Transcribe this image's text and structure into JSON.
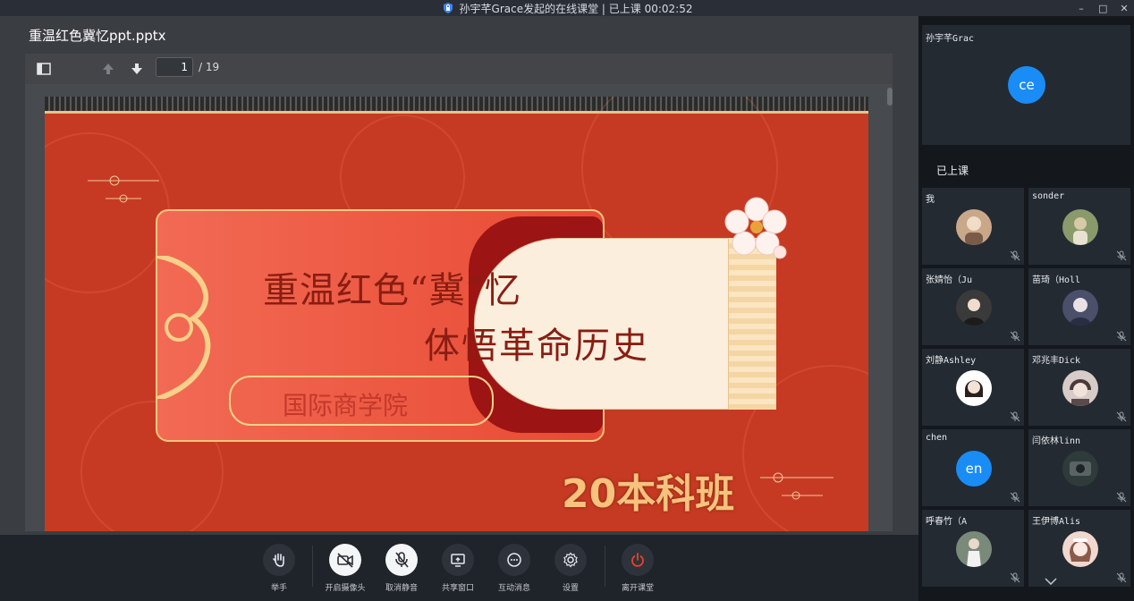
{
  "window": {
    "title": "孙宇芊Grace发起的在线课堂 | 已上课 00:02:52",
    "controls": [
      "–",
      "□",
      "✕"
    ]
  },
  "viewer": {
    "file_name": "重温红色冀忆ppt.pptx",
    "page_current": "1",
    "page_total": "/ 19"
  },
  "slide": {
    "title_line1": "重温红色“冀”忆",
    "title_line2": "体悟革命历史",
    "school": "国际商学院",
    "class_label": "20本科班"
  },
  "controls": [
    {
      "name": "raise-hand",
      "label": "举手",
      "icon": "hand-icon"
    },
    {
      "name": "camera",
      "label": "开启摄像头",
      "icon": "camera-off-icon"
    },
    {
      "name": "mute",
      "label": "取消静音",
      "icon": "mic-off-icon"
    },
    {
      "name": "share",
      "label": "共享窗口",
      "icon": "screen-share-icon"
    },
    {
      "name": "chat",
      "label": "互动消息",
      "icon": "chat-icon"
    },
    {
      "name": "settings",
      "label": "设置",
      "icon": "gear-icon"
    },
    {
      "name": "leave",
      "label": "离开课堂",
      "icon": "power-icon"
    }
  ],
  "panel": {
    "teacher_name": "孙宇芊Grac",
    "teacher_initials": "ce",
    "section_label": "已上课",
    "participants": [
      {
        "name": "我",
        "avatar": "photo",
        "color": "#c9a88a"
      },
      {
        "name": "sonder",
        "avatar": "photo",
        "color": "#8a9a6a"
      },
      {
        "name": "张婧怡（Ju",
        "avatar": "photo",
        "color": "#3a3a3a"
      },
      {
        "name": "苗琦（Holl",
        "avatar": "photo",
        "color": "#4a4f6a"
      },
      {
        "name": "刘静Ashley",
        "avatar": "photo",
        "color": "#e6d8cf"
      },
      {
        "name": "邓兆丰Dick",
        "avatar": "photo",
        "color": "#6a4a4a"
      },
      {
        "name": "chen",
        "avatar": "initials",
        "initials": "en",
        "color": "#1a8cf5"
      },
      {
        "name": "闫依林linn",
        "avatar": "photo",
        "color": "#2f3a3a"
      },
      {
        "name": "呼春竹（A",
        "avatar": "photo",
        "color": "#7a8a7a"
      },
      {
        "name": "王伊博Alis",
        "avatar": "photo",
        "color": "#f0d8d0"
      }
    ]
  },
  "colors": {
    "accent": "#1a8cf5",
    "leave": "#e2452f",
    "slide_red": "#c63a23"
  }
}
